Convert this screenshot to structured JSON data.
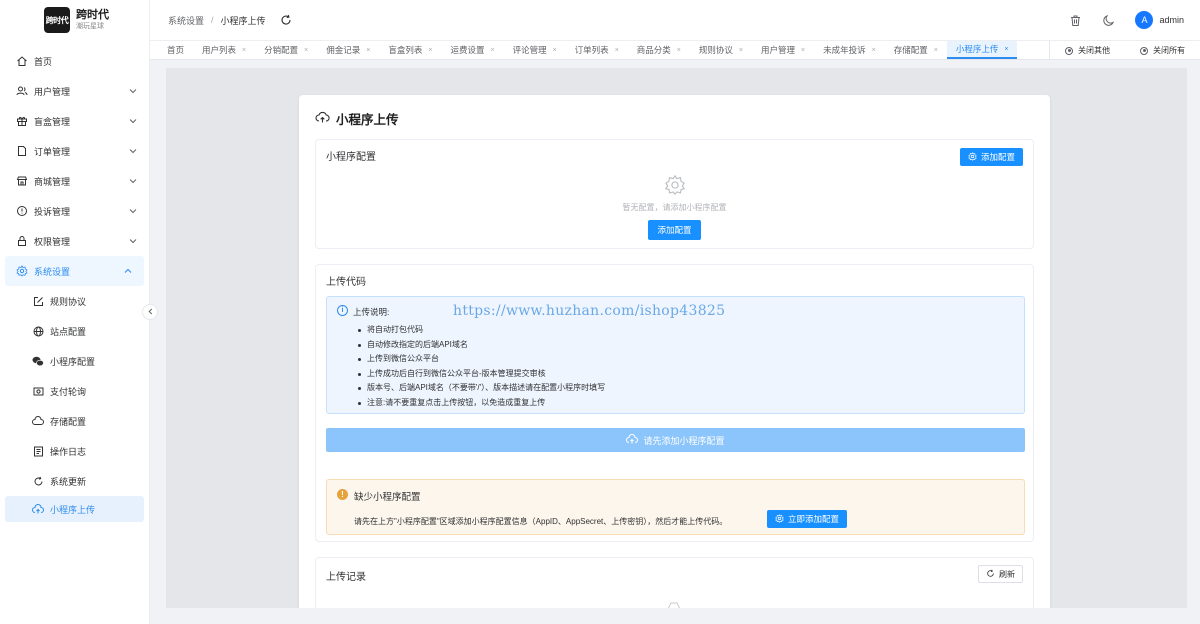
{
  "brand": {
    "logo_mark": "跨时代",
    "title": "跨时代",
    "subtitle": "潮玩星球"
  },
  "sidebar": {
    "items": [
      {
        "label": "首页",
        "icon": "home-icon"
      },
      {
        "label": "用户管理",
        "icon": "users-icon"
      },
      {
        "label": "盲盒管理",
        "icon": "gift-icon"
      },
      {
        "label": "订单管理",
        "icon": "document-icon"
      },
      {
        "label": "商城管理",
        "icon": "store-icon"
      },
      {
        "label": "投诉管理",
        "icon": "alert-circle-icon"
      },
      {
        "label": "权限管理",
        "icon": "lock-icon"
      },
      {
        "label": "系统设置",
        "icon": "settings-icon"
      }
    ],
    "sub_items": [
      {
        "label": "规则协议",
        "icon": "edit-icon"
      },
      {
        "label": "站点配置",
        "icon": "globe-icon"
      },
      {
        "label": "小程序配置",
        "icon": "wechat-icon"
      },
      {
        "label": "支付轮询",
        "icon": "payment-icon"
      },
      {
        "label": "存储配置",
        "icon": "cloud-icon"
      },
      {
        "label": "操作日志",
        "icon": "log-icon"
      },
      {
        "label": "系统更新",
        "icon": "refresh-icon"
      },
      {
        "label": "小程序上传",
        "icon": "cloud-upload-icon"
      }
    ]
  },
  "header": {
    "breadcrumb_parent": "系统设置",
    "breadcrumb_sep": "/",
    "breadcrumb_current": "小程序上传",
    "avatar_letter": "A",
    "user_name": "admin"
  },
  "tabs": {
    "items": [
      "首页",
      "用户列表",
      "分销配置",
      "佣金记录",
      "盲盒列表",
      "运费设置",
      "评论管理",
      "订单列表",
      "商品分类",
      "规则协议",
      "用户管理",
      "未成年投诉",
      "存储配置",
      "小程序上传"
    ],
    "close_glyph": "×",
    "close_others": "关闭其他",
    "close_all": "关闭所有"
  },
  "panel": {
    "title": "小程序上传",
    "config_card": {
      "title": "小程序配置",
      "add_button": "添加配置",
      "empty_text": "暂无配置，请添加小程序配置",
      "empty_button": "添加配置"
    },
    "upload_card": {
      "title": "上传代码",
      "info_title": "上传说明:",
      "info_items": [
        "将自动打包代码",
        "自动修改指定的后端API域名",
        "上传到微信公众平台",
        "上传成功后自行到微信公众平台-版本管理提交审核",
        "版本号、后端API域名（不要带'/'）、版本描述请在配置小程序时填写",
        "注意:请不要重复点击上传按钮，以免造成重复上传"
      ],
      "watermark": "https://www.huzhan.com/ishop43825",
      "disabled_button": "请先添加小程序配置",
      "warn_title": "缺少小程序配置",
      "warn_desc": "请先在上方\"小程序配置\"区域添加小程序配置信息（AppID、AppSecret、上传密钥），然后才能上传代码。",
      "warn_button": "立即添加配置"
    },
    "records_card": {
      "title": "上传记录",
      "refresh_button": "刷新"
    }
  },
  "colors": {
    "primary": "#1890ff",
    "accent_text": "#2d8cf0",
    "warning": "#e6a23c"
  }
}
